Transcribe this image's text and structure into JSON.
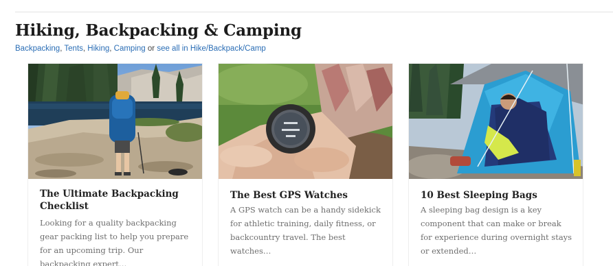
{
  "section": {
    "title": "Hiking, Backpacking & Camping",
    "subnav": {
      "links": [
        "Backpacking",
        "Tents",
        "Hiking",
        "Camping"
      ],
      "separator": ", ",
      "or_text": " or ",
      "see_all": "see all in Hike/Backpack/Camp"
    }
  },
  "cards": [
    {
      "title": "The Ultimate Backpacking Checklist",
      "excerpt": "Looking for a quality backpacking gear packing list to help you prepare for an upcoming trip. Our backpacking expert…",
      "image": "backpacker-at-lake-photo"
    },
    {
      "title": "The Best GPS Watches",
      "excerpt": "A GPS watch can be a handy sidekick for athletic training, daily fitness, or backcountry travel. The best watches…",
      "image": "gps-watch-on-wrist-photo"
    },
    {
      "title": "10 Best Sleeping Bags",
      "excerpt": "A sleeping bag design is a key component that can make or break for experience during overnight stays or extended…",
      "image": "sleeping-bag-in-tent-photo"
    }
  ],
  "colors": {
    "link": "#2a6db5",
    "heading": "#1c1c1c",
    "excerpt": "#6e6e6e"
  }
}
